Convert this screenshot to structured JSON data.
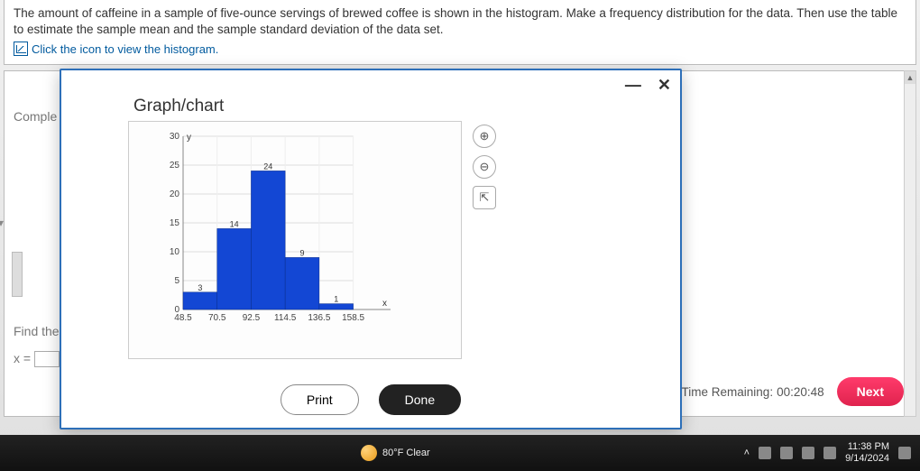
{
  "question": {
    "text": "The amount of caffeine in a sample of five-ounce servings of brewed coffee is shown in the histogram. Make a frequency distribution for the data. Then use the table to estimate the sample mean and the sample standard deviation of the data set.",
    "link_text": "Click the icon to view the histogram."
  },
  "bg": {
    "label1": "Comple",
    "label2": "Find the",
    "eq_lhs": "x ="
  },
  "modal": {
    "title": "Graph/chart",
    "minimize": "—",
    "close": "✕",
    "tools": {
      "zoom_in": "⊕",
      "zoom_out": "⊖",
      "popout": "⇱"
    },
    "buttons": {
      "print": "Print",
      "done": "Done"
    }
  },
  "chart_data": {
    "type": "bar",
    "title": "",
    "xlabel": "x",
    "ylabel": "y",
    "ylim": [
      0,
      30
    ],
    "yticks": [
      0,
      5,
      10,
      15,
      20,
      25,
      30
    ],
    "categories": [
      "48.5",
      "70.5",
      "92.5",
      "114.5",
      "136.5",
      "158.5"
    ],
    "values": [
      3,
      14,
      24,
      9,
      1
    ],
    "value_labels": [
      "3",
      "14",
      "24",
      "9",
      "1"
    ]
  },
  "footer": {
    "timer_label": "Time Remaining:",
    "timer_value": "00:20:48",
    "next": "Next"
  },
  "taskbar": {
    "weather": "80°F Clear",
    "chevron": "˄",
    "time": "11:38 PM",
    "date": "9/14/2024"
  }
}
